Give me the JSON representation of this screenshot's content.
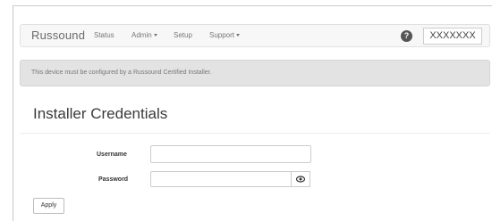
{
  "navbar": {
    "brand": "Russound",
    "items": [
      {
        "label": "Status",
        "has_dropdown": false
      },
      {
        "label": "Admin",
        "has_dropdown": true
      },
      {
        "label": "Setup",
        "has_dropdown": false
      },
      {
        "label": "Support",
        "has_dropdown": true
      }
    ],
    "help_icon": "?",
    "device_name": "XXXXXXX"
  },
  "alert": {
    "text": "This device must be configured by a Russound Certified Installer."
  },
  "page": {
    "title": "Installer Credentials"
  },
  "form": {
    "username_label": "Username",
    "username_value": "",
    "password_label": "Password",
    "password_value": "",
    "show_password_icon": "eye-icon",
    "apply_label": "Apply"
  },
  "colors": {
    "navbar_bg": "#f7f7f7",
    "alert_bg": "#e3e3e3",
    "help_icon_bg": "#555555"
  }
}
